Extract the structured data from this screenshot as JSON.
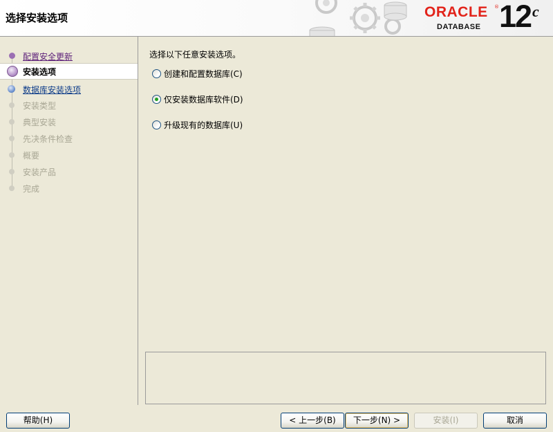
{
  "header": {
    "title": "选择安装选项",
    "logo": {
      "brand": "ORACLE",
      "registered": "®",
      "product": "DATABASE",
      "version": "12",
      "version_suffix": "c",
      "brand_color": "#e2231a"
    }
  },
  "sidebar": {
    "steps": [
      {
        "label": "配置安全更新",
        "state": "done"
      },
      {
        "label": "安装选项",
        "state": "current"
      },
      {
        "label": "数据库安装选项",
        "state": "next"
      },
      {
        "label": "安装类型",
        "state": "disabled"
      },
      {
        "label": "典型安装",
        "state": "disabled"
      },
      {
        "label": "先决条件检查",
        "state": "disabled"
      },
      {
        "label": "概要",
        "state": "disabled"
      },
      {
        "label": "安装产品",
        "state": "disabled"
      },
      {
        "label": "完成",
        "state": "disabled"
      }
    ]
  },
  "main": {
    "prompt": "选择以下任意安装选项。",
    "options": [
      {
        "label": "创建和配置数据库(C)",
        "checked": false
      },
      {
        "label": "仅安装数据库软件(D)",
        "checked": true
      },
      {
        "label": "升级现有的数据库(U)",
        "checked": false
      }
    ]
  },
  "footer": {
    "help": "帮助(H)",
    "back": "< 上一步(B)",
    "next": "下一步(N) >",
    "install": "安装(I)",
    "cancel": "取消"
  }
}
